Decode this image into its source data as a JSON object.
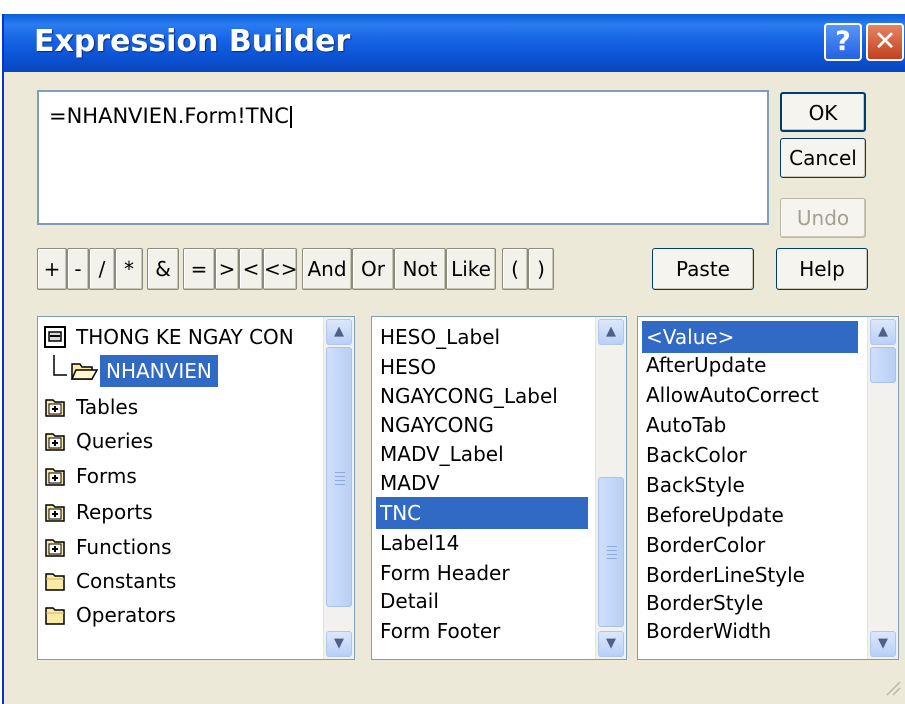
{
  "window": {
    "title": "Expression Builder",
    "help_glyph": "?",
    "close_glyph": "✕"
  },
  "expression": {
    "value": "=NHANVIEN.Form!TNC"
  },
  "buttons": {
    "ok": "OK",
    "cancel": "Cancel",
    "undo": "Undo",
    "paste": "Paste",
    "help": "Help"
  },
  "operators": [
    "+",
    "-",
    "/",
    "*",
    "&",
    "=",
    ">",
    "<",
    "<>",
    "And",
    "Or",
    "Not",
    "Like",
    "(",
    ")"
  ],
  "tree": {
    "root": "THONG KE NGAY CON",
    "child": "NHANVIEN",
    "items": [
      "Tables",
      "Queries",
      "Forms",
      "Reports",
      "Functions",
      "Constants",
      "Operators"
    ]
  },
  "middle_list": {
    "items": [
      "HESO_Label",
      "HESO",
      "NGAYCONG_Label",
      "NGAYCONG",
      "MADV_Label",
      "MADV",
      "TNC",
      "Label14",
      "Form Header",
      "Detail",
      "Form Footer"
    ],
    "selected": "TNC"
  },
  "right_list": {
    "items": [
      "<Value>",
      "AfterUpdate",
      "AllowAutoCorrect",
      "AutoTab",
      "BackColor",
      "BackStyle",
      "BeforeUpdate",
      "BorderColor",
      "BorderLineStyle",
      "BorderStyle",
      "BorderWidth"
    ],
    "selected": "<Value>"
  },
  "colors": {
    "title_bar": "#0b52d4",
    "selection": "#316ac5",
    "dialog_bg": "#ece9d8"
  }
}
